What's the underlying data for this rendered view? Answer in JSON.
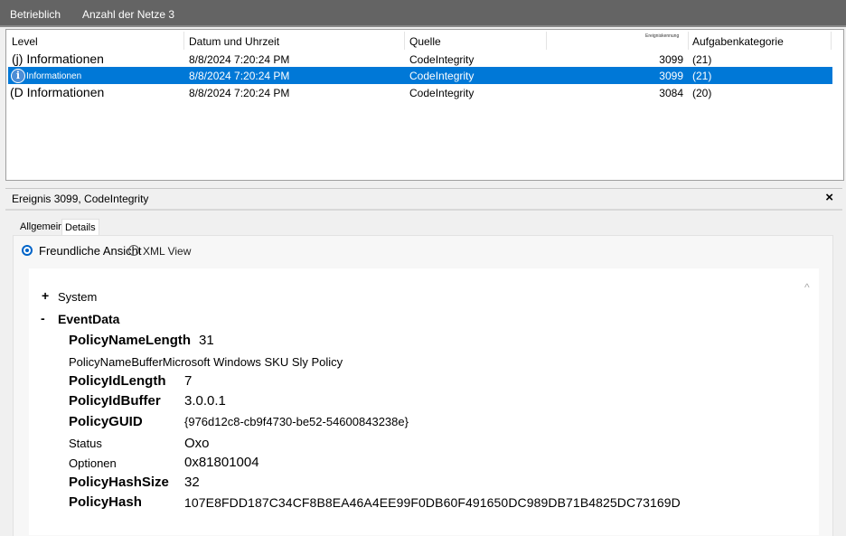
{
  "topbar": {
    "tab1": "Betrieblich",
    "tab2": "Anzahl der Netze 3"
  },
  "event_list": {
    "columns": {
      "level": "Level",
      "datetime": "Datum und Uhrzeit",
      "source": "Quelle",
      "eventid": "Ereigniskennung",
      "category": "Aufgabenkategorie"
    },
    "rows": [
      {
        "level": "(j) Informationen",
        "datetime": "8/8/2024 7:20:24 PM",
        "source": "CodeIntegrity",
        "eventid": "3099",
        "category": "(21)"
      },
      {
        "level": "Informationen",
        "datetime": "8/8/2024 7:20:24 PM",
        "source": "CodeIntegrity",
        "eventid": "3099",
        "category": "(21)"
      },
      {
        "level": "(D Informationen",
        "datetime": "8/8/2024 7:20:24 PM",
        "source": "CodeIntegrity",
        "eventid": "3084",
        "category": "(20)"
      }
    ],
    "selected_row": 1,
    "info_icon_glyph": "i"
  },
  "detail": {
    "title": "Ereignis 3099, CodeIntegrity",
    "close": "×",
    "tabs": {
      "general": "Allgemein",
      "details": "Details"
    },
    "view_friendly": "Freundliche Ansicht",
    "view_xml": "XML View",
    "scroll_glyph": "^",
    "tree": {
      "system_toggle": "+",
      "system": "System",
      "eventdata_toggle": "-",
      "eventdata": "EventData"
    },
    "fields": [
      {
        "key": "PolicyNameLength",
        "value": "31"
      },
      {
        "key": "PolicyNameBufferMicrosoft Windows SKU Sly Policy",
        "value": ""
      },
      {
        "key": "PolicyIdLength",
        "value": "7"
      },
      {
        "key": "PolicyIdBuffer",
        "value": "3.0.0.1"
      },
      {
        "key": "PolicyGUID",
        "value": "{976d12c8-cb9f4730-be52-54600843238e}"
      },
      {
        "key": "Status",
        "value": "Oxo"
      },
      {
        "key": "Optionen",
        "value": "0x81801004"
      },
      {
        "key": "PolicyHashSize",
        "value": "32"
      },
      {
        "key": "PolicyHash",
        "value": "107E8FDD187C34CF8B8EA46A4EE99F0DB60F491650DC989DB71B4825DC73169D"
      }
    ]
  },
  "colors": {
    "selection": "#0078d7",
    "topbar": "#646464",
    "radio_selected": "#0064c8"
  }
}
